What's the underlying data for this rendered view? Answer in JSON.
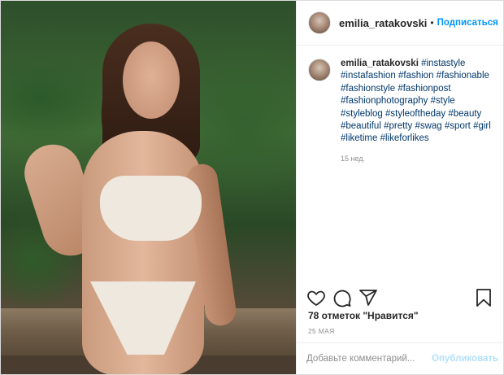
{
  "header": {
    "username": "emilia_ratakovski",
    "separator": "•",
    "follow_label": "Подписаться"
  },
  "caption": {
    "username": "emilia_ratakovski",
    "tags": [
      "#instastyle",
      "#instafashion",
      "#fashion",
      "#fashionable",
      "#fashionstyle",
      "#fashionpost",
      "#fashionphotography",
      "#style",
      "#styleblog",
      "#styleoftheday",
      "#beauty",
      "#beautiful",
      "#pretty",
      "#swag",
      "#sport",
      "#girl",
      "#liketime",
      "#likeforlikes"
    ],
    "time_ago": "15 нед."
  },
  "actions": {
    "like_icon": "heart-icon",
    "comment_icon": "comment-icon",
    "share_icon": "share-icon",
    "save_icon": "bookmark-icon"
  },
  "stats": {
    "likes": "78 отметок \"Нравится\"",
    "date": "25 МАЯ"
  },
  "comment": {
    "placeholder": "Добавьте комментарий...",
    "post_label": "Опубликовать"
  },
  "colors": {
    "link": "#0095f6",
    "hashtag": "#00376b",
    "post_disabled": "#b2dffc"
  }
}
